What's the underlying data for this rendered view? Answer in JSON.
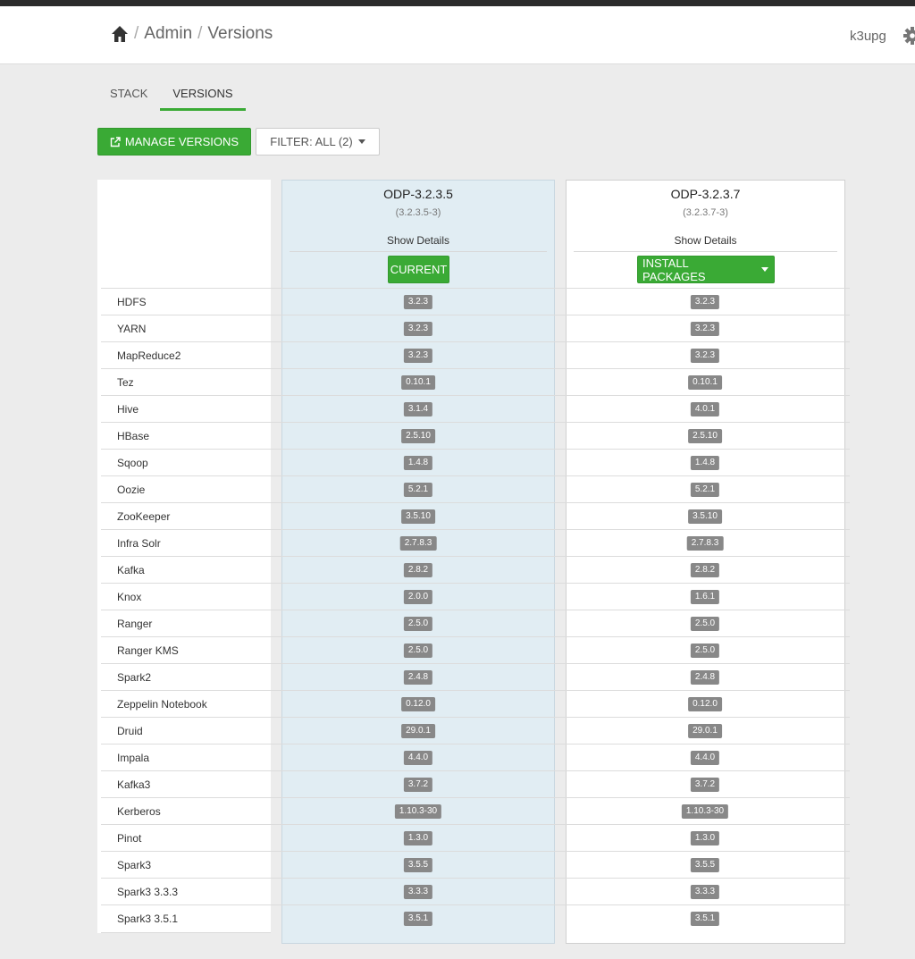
{
  "header": {
    "breadcrumb": [
      "Admin",
      "Versions"
    ],
    "breadcrumb_separator": "/",
    "home_icon": "home-icon",
    "user": "k3upg",
    "settings_icon": "gear-icon"
  },
  "tabs": [
    {
      "label": "STACK",
      "active": false
    },
    {
      "label": "VERSIONS",
      "active": true
    }
  ],
  "toolbar": {
    "manage_label": "MANAGE VERSIONS",
    "manage_icon": "external-link-icon",
    "filter_label": "FILTER: ALL (2)"
  },
  "versions": [
    {
      "name": "ODP-3.2.3.5",
      "build": "(3.2.3.5-3)",
      "details": "Show Details",
      "action": "CURRENT"
    },
    {
      "name": "ODP-3.2.3.7",
      "build": "(3.2.3.7-3)",
      "details": "Show Details",
      "action": "INSTALL PACKAGES"
    }
  ],
  "services": [
    {
      "name": "HDFS",
      "v1": "3.2.3",
      "v2": "3.2.3"
    },
    {
      "name": "YARN",
      "v1": "3.2.3",
      "v2": "3.2.3"
    },
    {
      "name": "MapReduce2",
      "v1": "3.2.3",
      "v2": "3.2.3"
    },
    {
      "name": "Tez",
      "v1": "0.10.1",
      "v2": "0.10.1"
    },
    {
      "name": "Hive",
      "v1": "3.1.4",
      "v2": "4.0.1"
    },
    {
      "name": "HBase",
      "v1": "2.5.10",
      "v2": "2.5.10"
    },
    {
      "name": "Sqoop",
      "v1": "1.4.8",
      "v2": "1.4.8"
    },
    {
      "name": "Oozie",
      "v1": "5.2.1",
      "v2": "5.2.1"
    },
    {
      "name": "ZooKeeper",
      "v1": "3.5.10",
      "v2": "3.5.10"
    },
    {
      "name": "Infra Solr",
      "v1": "2.7.8.3",
      "v2": "2.7.8.3"
    },
    {
      "name": "Kafka",
      "v1": "2.8.2",
      "v2": "2.8.2"
    },
    {
      "name": "Knox",
      "v1": "2.0.0",
      "v2": "1.6.1"
    },
    {
      "name": "Ranger",
      "v1": "2.5.0",
      "v2": "2.5.0"
    },
    {
      "name": "Ranger KMS",
      "v1": "2.5.0",
      "v2": "2.5.0"
    },
    {
      "name": "Spark2",
      "v1": "2.4.8",
      "v2": "2.4.8"
    },
    {
      "name": "Zeppelin Notebook",
      "v1": "0.12.0",
      "v2": "0.12.0"
    },
    {
      "name": "Druid",
      "v1": "29.0.1",
      "v2": "29.0.1"
    },
    {
      "name": "Impala",
      "v1": "4.4.0",
      "v2": "4.4.0"
    },
    {
      "name": "Kafka3",
      "v1": "3.7.2",
      "v2": "3.7.2"
    },
    {
      "name": "Kerberos",
      "v1": "1.10.3-30",
      "v2": "1.10.3-30"
    },
    {
      "name": "Pinot",
      "v1": "1.3.0",
      "v2": "1.3.0"
    },
    {
      "name": "Spark3",
      "v1": "3.5.5",
      "v2": "3.5.5"
    },
    {
      "name": "Spark3 3.3.3",
      "v1": "3.3.3",
      "v2": "3.3.3"
    },
    {
      "name": "Spark3 3.5.1",
      "v1": "3.5.1",
      "v2": "3.5.1"
    }
  ],
  "colors": {
    "accent": "#3aaa35",
    "current_column": "#e1edf3",
    "badge": "#888888"
  }
}
